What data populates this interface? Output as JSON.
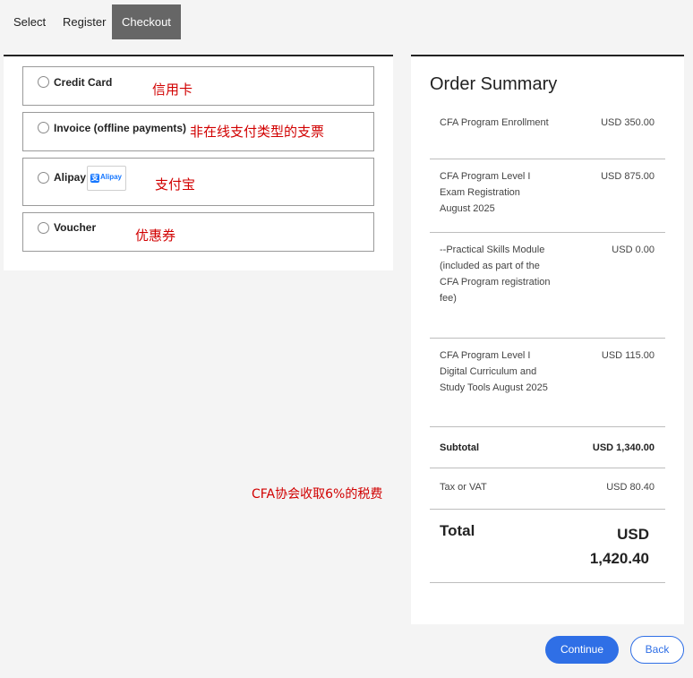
{
  "tabs": [
    {
      "label": "Select"
    },
    {
      "label": "Register"
    },
    {
      "label": "Checkout",
      "active": true
    }
  ],
  "payment_options": [
    {
      "label": "Credit Card",
      "annotation": "信用卡"
    },
    {
      "label": "Invoice (offline payments)",
      "annotation": "非在线支付类型的支票"
    },
    {
      "label": "Alipay",
      "annotation": "支付宝",
      "badge_text": "Alipay"
    },
    {
      "label": "Voucher",
      "annotation": "优惠券"
    }
  ],
  "summary": {
    "title": "Order Summary",
    "items": [
      {
        "desc": "CFA Program Enrollment",
        "amount": "USD 350.00"
      },
      {
        "desc": "CFA Program Level I Exam Registration August 2025",
        "amount": "USD 875.00"
      },
      {
        "desc": "--Practical Skills Module (included as part of the CFA Program registration fee)",
        "amount": "USD 0.00"
      },
      {
        "desc": "CFA Program Level I Digital Curriculum and Study Tools August 2025",
        "amount": "USD 115.00"
      }
    ],
    "subtotal": {
      "label": "Subtotal",
      "amount": "USD 1,340.00"
    },
    "tax": {
      "label": "Tax or VAT",
      "amount": "USD 80.40"
    },
    "total": {
      "label": "Total",
      "amount": "USD 1,420.40"
    }
  },
  "tax_annotation": "CFA协会收取6%的税费",
  "buttons": {
    "continue": "Continue",
    "back": "Back"
  },
  "colors": {
    "primary": "#2f6fe6",
    "annotation": "#d10000",
    "active_tab": "#666666"
  }
}
